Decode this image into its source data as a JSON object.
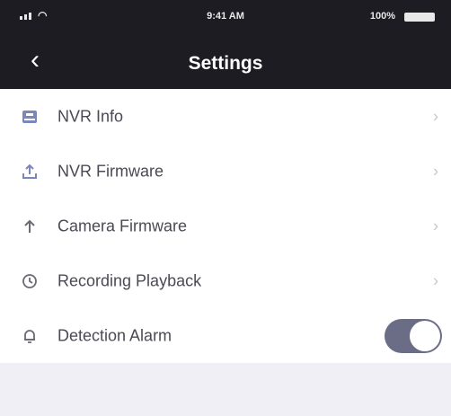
{
  "status_bar": {
    "time": "9:41 AM",
    "battery": "100%"
  },
  "nav": {
    "title": "Settings"
  },
  "items": [
    {
      "label": "NVR Info",
      "icon": "nvr-info-icon",
      "control": "chevron"
    },
    {
      "label": "NVR Firmware",
      "icon": "upload-icon",
      "control": "chevron"
    },
    {
      "label": "Camera Firmware",
      "icon": "arrow-up-icon",
      "control": "chevron"
    },
    {
      "label": "Recording Playback",
      "icon": "playback-icon",
      "control": "chevron"
    },
    {
      "label": "Detection Alarm",
      "icon": "bell-icon",
      "control": "toggle",
      "value": true
    }
  ],
  "colors": {
    "header_bg": "#1c1c22",
    "toggle_on": "#6a6d85",
    "icon": "#7a87b8"
  }
}
